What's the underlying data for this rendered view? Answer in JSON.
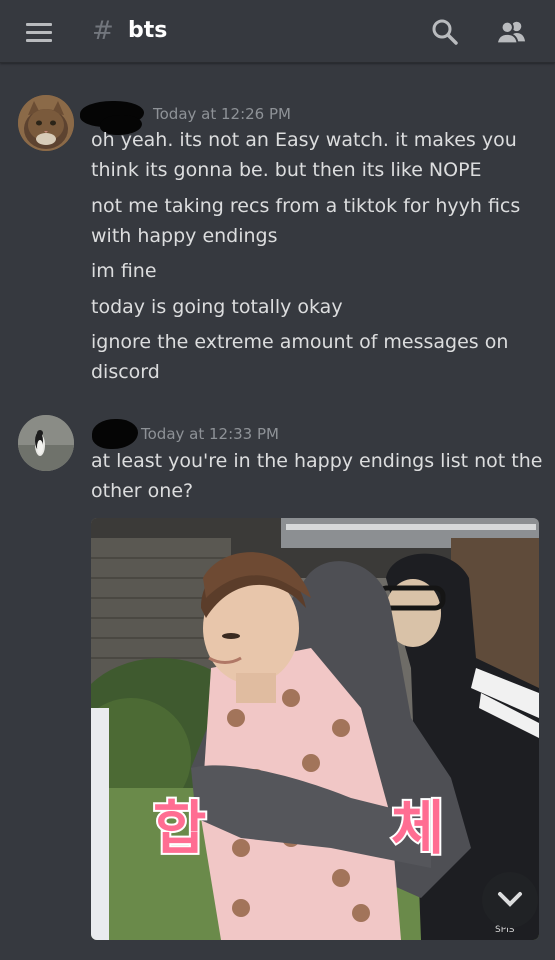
{
  "header": {
    "hash": "#",
    "channel": "bts"
  },
  "messages": [
    {
      "timestamp": "Today at 12:26 PM",
      "lines": [
        "oh yeah. its not an Easy watch. it makes you",
        "think its gonna be. but then its like NOPE",
        "not me taking recs from a tiktok for hyyh fics",
        "with happy endings",
        "im fine",
        "today is going totally okay",
        "ignore the extreme amount of messages on",
        "discord"
      ]
    },
    {
      "timestamp": "Today at 12:33 PM",
      "lines": [
        "at least you're in the happy endings list not the",
        "other one?"
      ]
    }
  ],
  "attachment": {
    "caption_left": "합",
    "caption_right": "체",
    "watermark": "SPIS"
  },
  "colors": {
    "background": "#36393f",
    "text": "#dcddde",
    "timestamp": "#8e9297",
    "header_icons": "#b9bbbe"
  }
}
